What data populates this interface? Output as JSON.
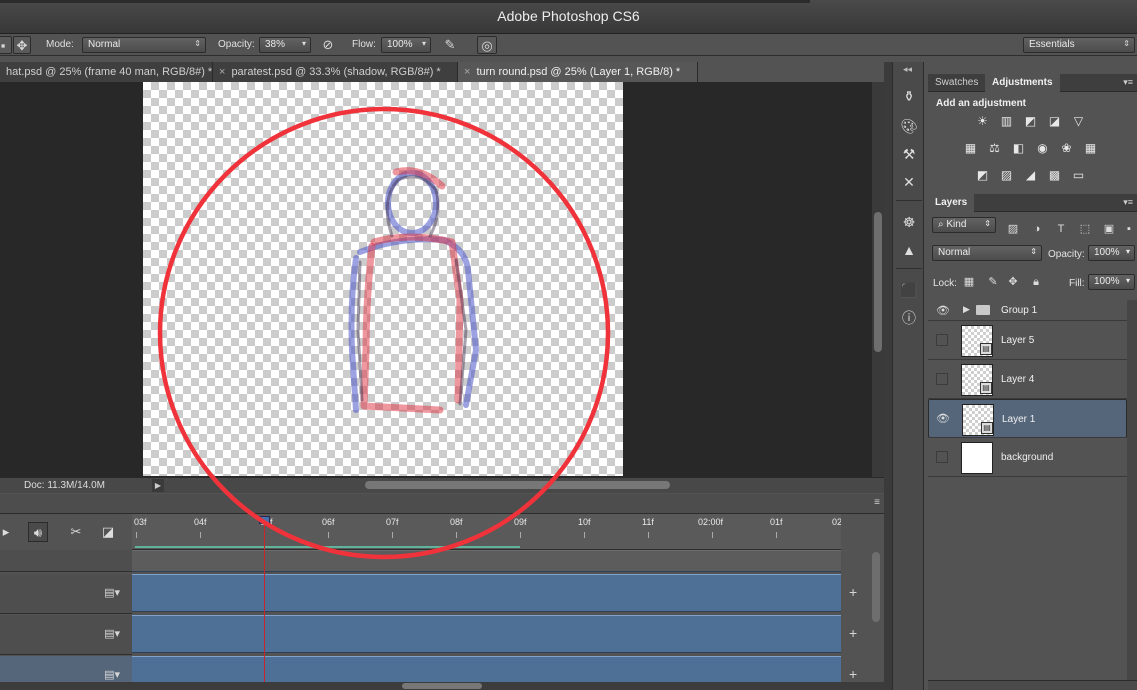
{
  "app": {
    "title": "Adobe Photoshop CS6"
  },
  "options": {
    "mode_label": "Mode:",
    "mode_value": "Normal",
    "opacity_label": "Opacity:",
    "opacity_value": "38%",
    "flow_label": "Flow:",
    "flow_value": "100%",
    "workspace": "Essentials"
  },
  "tabs": [
    {
      "label": "hat.psd @ 25% (frame 40 man, RGB/8#) *"
    },
    {
      "label": "paratest.psd @ 33.3% (shadow, RGB/8#) *"
    },
    {
      "label": "turn round.psd @ 25% (Layer 1, RGB/8) *"
    }
  ],
  "status": {
    "doc": "Doc: 11.3M/14.0M"
  },
  "timeline": {
    "ticks": [
      "03f",
      "04f",
      "05f",
      "06f",
      "07f",
      "08f",
      "09f",
      "10f",
      "11f",
      "02:00f",
      "01f",
      "02"
    ]
  },
  "adjust": {
    "tab_swatches": "Swatches",
    "tab_adjustments": "Adjustments",
    "title": "Add an adjustment"
  },
  "layers": {
    "tab": "Layers",
    "kind": "Kind",
    "blend": "Normal",
    "opacity_label": "Opacity:",
    "opacity_value": "100%",
    "lock_label": "Lock:",
    "fill_label": "Fill:",
    "fill_value": "100%",
    "group": "Group 1",
    "items": [
      {
        "name": "Layer 5"
      },
      {
        "name": "Layer 4"
      },
      {
        "name": "Layer 1"
      },
      {
        "name": "background"
      }
    ]
  },
  "colors": {
    "annotation_circle": "#f0323a",
    "selected_layer": "#55667b",
    "track": "#4e6f96",
    "playhead": "#c8262a"
  }
}
